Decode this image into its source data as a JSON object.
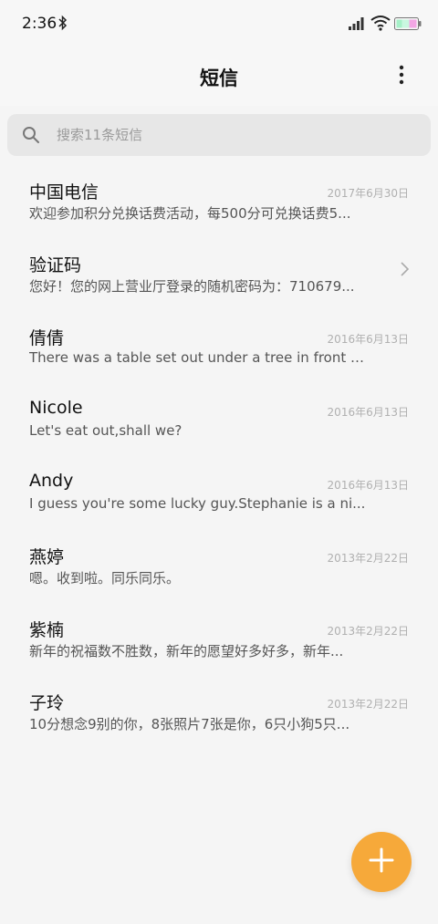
{
  "status_bar": {
    "time": "2:36",
    "icons": [
      "bluetooth-icon",
      "signal-icon",
      "wifi-icon",
      "battery-icon"
    ]
  },
  "header": {
    "title": "短信",
    "menu_icon": "more-vertical-icon"
  },
  "search": {
    "placeholder": "搜索11条短信",
    "icon": "search-icon"
  },
  "conversations": [
    {
      "name": "中国电信",
      "date": "2017年6月30日",
      "preview": "欢迎参加积分兑换话费活动，每500分可兑换话费5..."
    },
    {
      "name": "验证码",
      "date": "",
      "preview": "您好！您的网上营业厅登录的随机密码为：710679..."
    },
    {
      "name": "倩倩",
      "date": "2016年6月13日",
      "preview": "There was a table set out under a tree in front of..."
    },
    {
      "name": "Nicole",
      "date": "2016年6月13日",
      "preview": "Let's eat out,shall we?"
    },
    {
      "name": "Andy",
      "date": "2016年6月13日",
      "preview": "I guess you're some lucky guy.Stephanie is a ni..."
    },
    {
      "name": "燕婷",
      "date": "2013年2月22日",
      "preview": "嗯。收到啦。同乐同乐。"
    },
    {
      "name": "紫楠",
      "date": "2013年2月22日",
      "preview": "新年的祝福数不胜数，新年的愿望好多好多，新年..."
    },
    {
      "name": "子玲",
      "date": "2013年2月22日",
      "preview": "10分想念9别的你，8张照片7张是你，6只小狗5只..."
    }
  ],
  "fab": {
    "icon": "plus-icon"
  },
  "colors": {
    "accent": "#f6a93a",
    "background": "#f5f5f5",
    "search_bg": "#e7e7e7"
  }
}
